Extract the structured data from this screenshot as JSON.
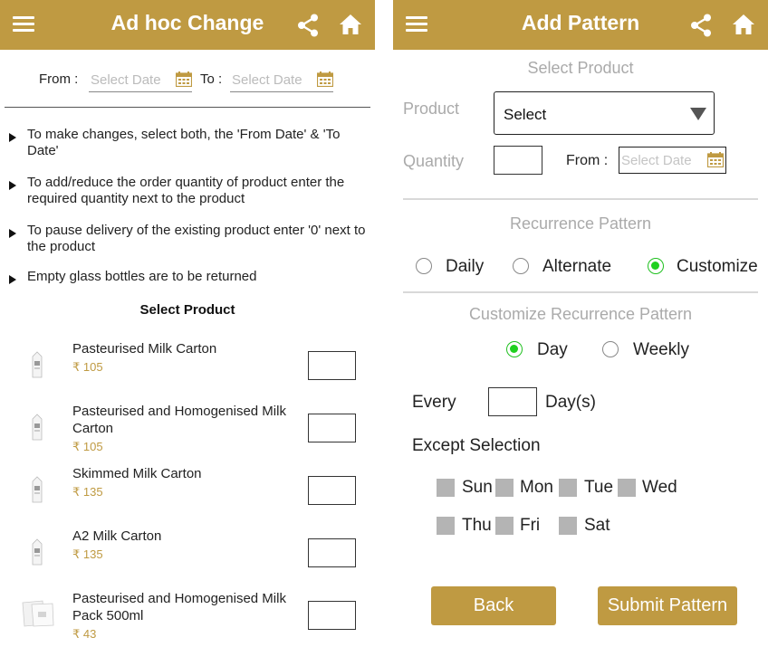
{
  "left": {
    "header": {
      "title": "Ad hoc Change"
    },
    "from_label": "From :",
    "from_placeholder": "Select Date",
    "to_label": "To :",
    "to_placeholder": "Select Date",
    "instructions": [
      "To make changes, select both, the 'From Date' & 'To Date'",
      "To add/reduce the order quantity of product enter the required quantity next to the product",
      "To pause delivery of the existing product enter '0' next to the product",
      "Empty glass bottles are to be returned"
    ],
    "select_product_heading": "Select Product",
    "products": [
      {
        "name": "Pasteurised Milk Carton",
        "price": "₹ 105",
        "icon": "milk-carton-icon"
      },
      {
        "name": "Pasteurised and Homogenised Milk Carton",
        "price": "₹ 105",
        "icon": "milk-carton-icon"
      },
      {
        "name": "Skimmed Milk Carton",
        "price": "₹ 135",
        "icon": "milk-carton-icon"
      },
      {
        "name": "A2 Milk Carton",
        "price": "₹ 135",
        "icon": "milk-carton-icon"
      },
      {
        "name": "Pasteurised and Homogenised Milk Pack 500ml",
        "price": "₹ 43",
        "icon": "milk-pack-icon"
      }
    ]
  },
  "right": {
    "header": {
      "title": "Add Pattern"
    },
    "select_product_heading": "Select Product",
    "product_label": "Product",
    "product_select_value": "Select",
    "quantity_label": "Quantity",
    "from_label": "From :",
    "from_placeholder": "Select Date",
    "recurrence_heading": "Recurrence Pattern",
    "recurrence_options": [
      "Daily",
      "Alternate",
      "Customize"
    ],
    "recurrence_selected": "Customize",
    "customize_heading": "Customize Recurrence Pattern",
    "customize_options": [
      "Day",
      "Weekly"
    ],
    "customize_selected": "Day",
    "every_label": "Every",
    "days_label": "Day(s)",
    "except_label": "Except Selection",
    "weekdays_row1": [
      "Sun",
      "Mon",
      "Tue",
      "Wed"
    ],
    "weekdays_row2": [
      "Thu",
      "Fri",
      "Sat"
    ],
    "back_button": "Back",
    "submit_button": "Submit Pattern"
  },
  "colors": {
    "brand": "#bf9a42",
    "radio_selected": "#1fd01f",
    "checkbox": "#b4b4b4"
  }
}
